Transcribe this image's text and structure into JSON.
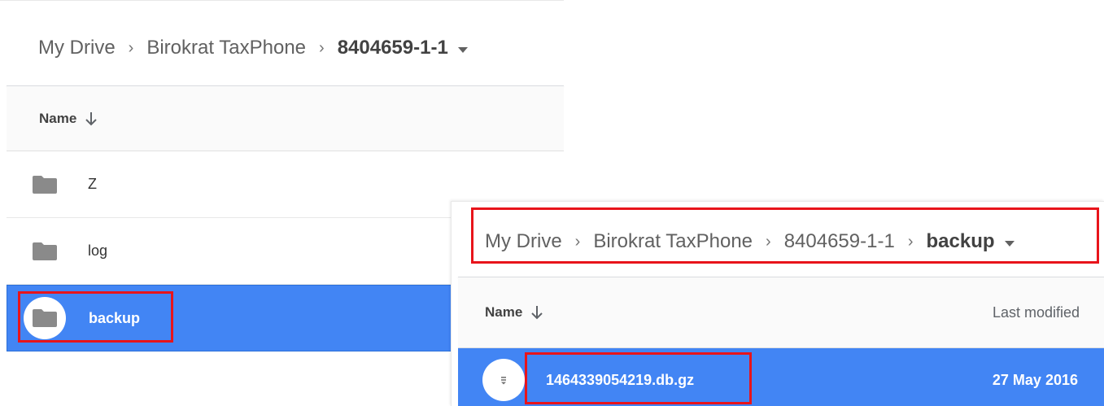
{
  "left_panel": {
    "breadcrumb": {
      "items": [
        "My Drive",
        "Birokrat TaxPhone"
      ],
      "current": "8404659-1-1"
    },
    "list_header": {
      "name_label": "Name"
    },
    "rows": [
      {
        "name": "Z",
        "type": "folder",
        "selected": false
      },
      {
        "name": "log",
        "type": "folder",
        "selected": false
      },
      {
        "name": "backup",
        "type": "folder",
        "selected": true
      }
    ]
  },
  "right_panel": {
    "breadcrumb": {
      "items": [
        "My Drive",
        "Birokrat TaxPhone",
        "8404659-1-1"
      ],
      "current": "backup"
    },
    "list_header": {
      "name_label": "Name",
      "modified_label": "Last modified"
    },
    "rows": [
      {
        "name": "1464339054219.db.gz",
        "type": "file",
        "modified": "27 May 2016",
        "selected": true
      }
    ]
  },
  "colors": {
    "selection": "#4285f4",
    "annotation": "#e8141b",
    "folder_icon": "#8a8a8a"
  },
  "icons": [
    "folder-icon",
    "file-icon",
    "sort-arrow-icon",
    "chevron-right-icon",
    "caret-down-icon"
  ]
}
